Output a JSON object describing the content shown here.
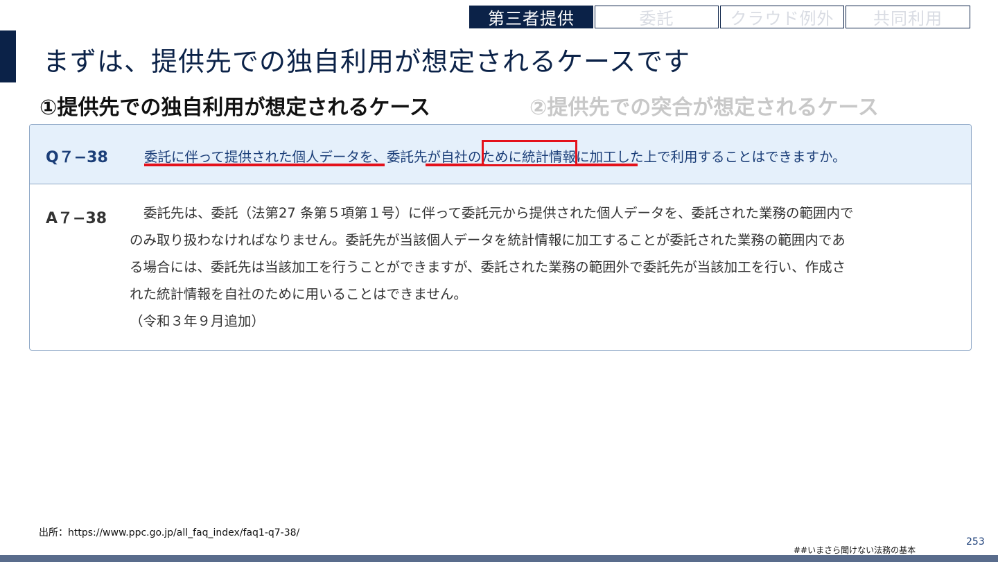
{
  "tabs": [
    {
      "label": "第三者提供",
      "active": true
    },
    {
      "label": "委託",
      "active": false
    },
    {
      "label": "クラウド例外",
      "active": false
    },
    {
      "label": "共同利用",
      "active": false
    }
  ],
  "title": "まずは、提供先での独自利用が想定されるケースです",
  "case_active": "①提供先での独自利用が想定されるケース",
  "case_inactive": "②提供先での突合が想定されるケース",
  "question": {
    "number": "Q７−38",
    "text": "委託に伴って提供された個人データを、委託先が自社のために統計情報に加工した上で利用することはできますか。"
  },
  "answer": {
    "number": "A７−38",
    "lines": [
      "委託先は、委託（法第27 条第５項第１号）に伴って委託元から提供された個人データを、委託された業務の範囲内で",
      "のみ取り扱わなければなりません。委託先が当該個人データを統計情報に加工することが委託された業務の範囲内であ",
      "る場合には、委託先は当該加工を行うことができますが、委託された業務の範囲外で委託先が当該加工を行い、作成さ",
      "れた統計情報を自社のために用いることはできません。",
      "（令和３年９月追加）"
    ]
  },
  "source": "出所：https://www.ppc.go.jp/all_faq_index/faq1-q7-38/",
  "footer_tag": "##いまさら聞けない法務の基本",
  "page_number": "253",
  "colors": {
    "navy": "#0b2248",
    "highlight_red": "#e4111b",
    "question_bg": "#e5f0fb"
  }
}
